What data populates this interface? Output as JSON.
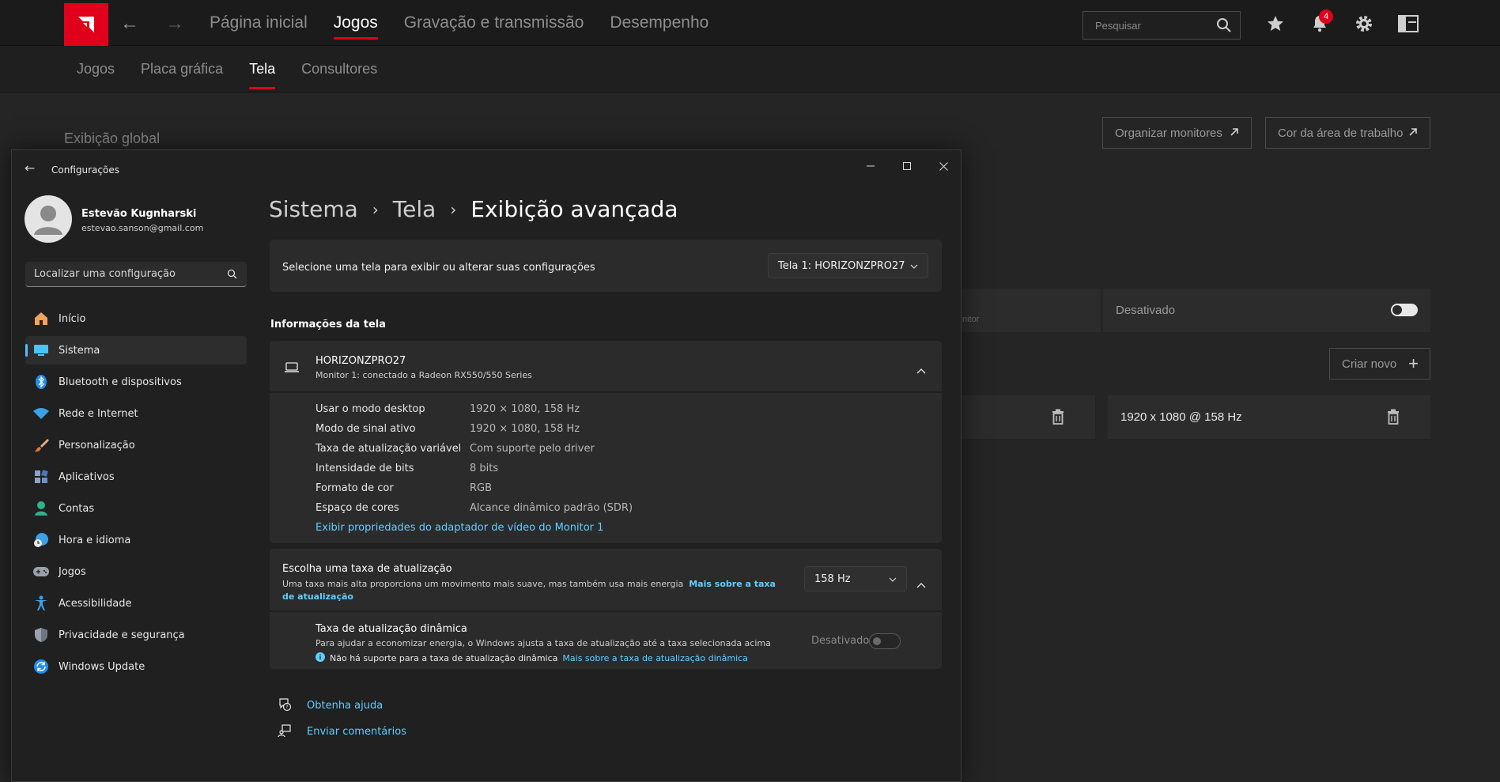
{
  "amd": {
    "nav_back": "←",
    "nav_forward": "→",
    "tabs": [
      {
        "label": "Página inicial"
      },
      {
        "label": "Jogos"
      },
      {
        "label": "Gravação e transmissão"
      },
      {
        "label": "Desempenho"
      }
    ],
    "search_placeholder": "Pesquisar",
    "notification_count": "4",
    "subtabs": [
      {
        "label": "Jogos"
      },
      {
        "label": "Placa gráfica"
      },
      {
        "label": "Tela"
      },
      {
        "label": "Consultores"
      }
    ],
    "global_title": "Exibição global",
    "organize_button": "Organizar monitores",
    "desktop_color_button": "Cor da área de trabalho",
    "partial_text": "nitor",
    "disabled_label": "Desativado",
    "create_new_button": "Criar novo",
    "create_new_plus": "+",
    "resolution_item": "1920 x 1080 @ 158 Hz",
    "accent": "#e0001b"
  },
  "settings": {
    "window_title": "Configurações",
    "back": "←",
    "user": {
      "name": "Estevão Kugnharski",
      "email": "estevao.sanson@gmail.com"
    },
    "find_placeholder": "Localizar uma configuração",
    "nav": [
      {
        "label": "Início",
        "icon": "home-icon"
      },
      {
        "label": "Sistema",
        "icon": "system-icon"
      },
      {
        "label": "Bluetooth e dispositivos",
        "icon": "bluetooth-icon"
      },
      {
        "label": "Rede e Internet",
        "icon": "wifi-icon"
      },
      {
        "label": "Personalização",
        "icon": "brush-icon"
      },
      {
        "label": "Aplicativos",
        "icon": "apps-icon"
      },
      {
        "label": "Contas",
        "icon": "account-icon"
      },
      {
        "label": "Hora e idioma",
        "icon": "clock-globe-icon"
      },
      {
        "label": "Jogos",
        "icon": "gamepad-icon"
      },
      {
        "label": "Acessibilidade",
        "icon": "accessibility-icon"
      },
      {
        "label": "Privacidade e segurança",
        "icon": "shield-icon"
      },
      {
        "label": "Windows Update",
        "icon": "update-icon"
      }
    ],
    "breadcrumb": {
      "part1": "Sistema",
      "sep": "›",
      "part2": "Tela",
      "current": "Exibição avançada"
    },
    "select_display_text": "Selecione uma tela para exibir ou alterar suas configurações",
    "selected_display": "Tela 1: HORIZONZPRO27",
    "display_info_title": "Informações da tela",
    "monitor": {
      "name": "HORIZONZPRO27",
      "subtitle": "Monitor 1: conectado a Radeon RX550/550 Series"
    },
    "info_rows": [
      {
        "label": "Usar o modo desktop",
        "value": "1920 × 1080, 158 Hz"
      },
      {
        "label": "Modo de sinal ativo",
        "value": "1920 × 1080, 158 Hz"
      },
      {
        "label": "Taxa de atualização variável",
        "value": "Com suporte pelo driver"
      },
      {
        "label": "Intensidade de bits",
        "value": "8 bits"
      },
      {
        "label": "Formato de cor",
        "value": "RGB"
      },
      {
        "label": "Espaço de cores",
        "value": "Alcance dinâmico padrão (SDR)"
      }
    ],
    "adapter_link": "Exibir propriedades do adaptador de vídeo do Monitor 1",
    "refresh": {
      "title": "Escolha uma taxa de atualização",
      "desc": "Uma taxa mais alta proporciona um movimento mais suave, mas também usa mais energia",
      "link": "Mais sobre a taxa de atualização",
      "value": "158 Hz"
    },
    "dynamic": {
      "title": "Taxa de atualização dinâmica",
      "desc": "Para ajudar a economizar energia, o Windows ajusta a taxa de atualização até a taxa selecionada acima",
      "note": "Não há suporte para a taxa de atualização dinâmica",
      "note_link": "Mais sobre a taxa de atualização dinâmica",
      "state": "Desativado"
    },
    "help_link": "Obtenha ajuda",
    "feedback_link": "Enviar comentários",
    "accent": "#60cdff"
  }
}
